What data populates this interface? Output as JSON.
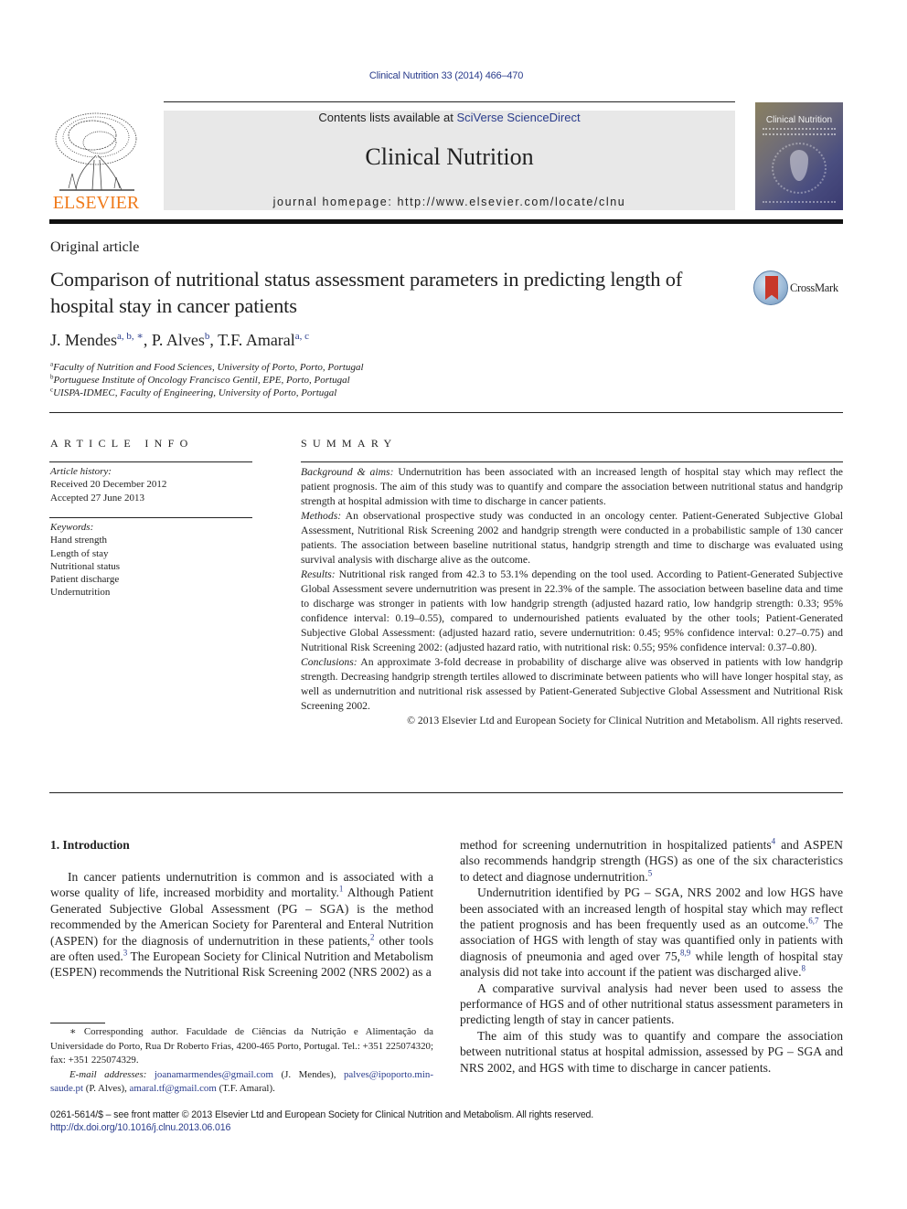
{
  "header": {
    "citation": "Clinical Nutrition 33 (2014) 466–470",
    "contents_prefix": "Contents lists available at ",
    "contents_link": "SciVerse ScienceDirect",
    "journal_title": "Clinical Nutrition",
    "homepage_label": "journal homepage: ",
    "homepage_url": "http://www.elsevier.com/locate/clnu",
    "publisher_logo_text": "ELSEVIER",
    "cover_title": "Clinical Nutrition",
    "colors": {
      "link": "#2a3c8c",
      "elsevier_orange": "#f07a1a",
      "header_box": "#e8e8e8"
    }
  },
  "article": {
    "type": "Original article",
    "title": "Comparison of nutritional status assessment parameters in predicting length of hospital stay in cancer patients",
    "crossmark_label": "CrossMark",
    "authors": [
      {
        "name": "J. Mendes",
        "marks": "a, b, ∗",
        "sep": ", "
      },
      {
        "name": "P. Alves",
        "marks": "b",
        "sep": ", "
      },
      {
        "name": "T.F. Amaral",
        "marks": "a, c",
        "sep": ""
      }
    ],
    "affiliations": [
      {
        "mark": "a",
        "text": "Faculty of Nutrition and Food Sciences, University of Porto, Porto, Portugal"
      },
      {
        "mark": "b",
        "text": "Portuguese Institute of Oncology Francisco Gentil, EPE, Porto, Portugal"
      },
      {
        "mark": "c",
        "text": "UISPA-IDMEC, Faculty of Engineering, University of Porto, Portugal"
      }
    ]
  },
  "article_info": {
    "heading": "ARTICLE INFO",
    "history_label": "Article history:",
    "received": "Received 20 December 2012",
    "accepted": "Accepted 27 June 2013",
    "keywords_label": "Keywords:",
    "keywords": [
      "Hand strength",
      "Length of stay",
      "Nutritional status",
      "Patient discharge",
      "Undernutrition"
    ]
  },
  "summary": {
    "heading": "SUMMARY",
    "sections": [
      {
        "label": "Background & aims:",
        "text": " Undernutrition has been associated with an increased length of hospital stay which may reflect the patient prognosis. The aim of this study was to quantify and compare the association between nutritional status and handgrip strength at hospital admission with time to discharge in cancer patients."
      },
      {
        "label": "Methods:",
        "text": " An observational prospective study was conducted in an oncology center. Patient-Generated Subjective Global Assessment, Nutritional Risk Screening 2002 and handgrip strength were conducted in a probabilistic sample of 130 cancer patients. The association between baseline nutritional status, handgrip strength and time to discharge was evaluated using survival analysis with discharge alive as the outcome."
      },
      {
        "label": "Results:",
        "text": " Nutritional risk ranged from 42.3 to 53.1% depending on the tool used. According to Patient-Generated Subjective Global Assessment severe undernutrition was present in 22.3% of the sample. The association between baseline data and time to discharge was stronger in patients with low handgrip strength (adjusted hazard ratio, low handgrip strength: 0.33; 95% confidence interval: 0.19–0.55), compared to undernourished patients evaluated by the other tools; Patient-Generated Subjective Global Assessment: (adjusted hazard ratio, severe undernutrition: 0.45; 95% confidence interval: 0.27–0.75) and Nutritional Risk Screening 2002: (adjusted hazard ratio, with nutritional risk: 0.55; 95% confidence interval: 0.37–0.80)."
      },
      {
        "label": "Conclusions:",
        "text": " An approximate 3-fold decrease in probability of discharge alive was observed in patients with low handgrip strength. Decreasing handgrip strength tertiles allowed to discriminate between patients who will have longer hospital stay, as well as undernutrition and nutritional risk assessed by Patient-Generated Subjective Global Assessment and Nutritional Risk Screening 2002."
      }
    ],
    "copyright": "© 2013 Elsevier Ltd and European Society for Clinical Nutrition and Metabolism. All rights reserved."
  },
  "body": {
    "intro_heading": "1.  Introduction",
    "left_paragraphs": [
      {
        "parts": [
          {
            "t": "In cancer patients undernutrition is common and is associated with a worse quality of life, increased morbidity and mortality."
          },
          {
            "ref": "1"
          },
          {
            "t": " Although Patient Generated Subjective Global Assessment (PG – SGA) is the method recommended by the American Society for Parenteral and Enteral Nutrition (ASPEN) for the diagnosis of undernutrition in these patients,"
          },
          {
            "ref": "2"
          },
          {
            "t": " other tools are often used."
          },
          {
            "ref": "3"
          },
          {
            "t": " The European Society for Clinical Nutrition and Metabolism (ESPEN) recommends the Nutritional Risk Screening 2002 (NRS 2002) as a"
          }
        ]
      }
    ],
    "right_paragraphs": [
      {
        "noindent": true,
        "parts": [
          {
            "t": "method for screening undernutrition in hospitalized patients"
          },
          {
            "ref": "4"
          },
          {
            "t": " and ASPEN also recommends handgrip strength (HGS) as one of the six characteristics to detect and diagnose undernutrition."
          },
          {
            "ref": "5"
          }
        ]
      },
      {
        "parts": [
          {
            "t": "Undernutrition identified by PG – SGA, NRS 2002 and low HGS have been associated with an increased length of hospital stay which may reflect the patient prognosis and has been frequently used as an outcome."
          },
          {
            "ref": "6,7"
          },
          {
            "t": " The association of HGS with length of stay was quantified only in patients with diagnosis of pneumonia and aged over 75,"
          },
          {
            "ref": "8,9"
          },
          {
            "t": " while length of hospital stay analysis did not take into account if the patient was discharged alive."
          },
          {
            "ref": "8"
          }
        ]
      },
      {
        "parts": [
          {
            "t": "A comparative survival analysis had never been used to assess the performance of HGS and of other nutritional status assessment parameters in predicting length of stay in cancer patients."
          }
        ]
      },
      {
        "parts": [
          {
            "t": "The aim of this study was to quantify and compare the association between nutritional status at hospital admission, assessed by PG – SGA and NRS 2002, and HGS with time to discharge in cancer patients."
          }
        ]
      }
    ]
  },
  "footnote": {
    "corresponding": "∗ Corresponding author. Faculdade de Ciências da Nutrição e Alimentação da Universidade do Porto, Rua Dr Roberto Frias, 4200-465 Porto, Portugal. Tel.: +351 225074320; fax: +351 225074329.",
    "email_label": "E-mail addresses:",
    "emails": [
      {
        "address": "joanamarmendes@gmail.com",
        "who": " (J. Mendes), "
      },
      {
        "address": "palves@ipoporto.min-saude.pt",
        "who": " (P. Alves), "
      },
      {
        "address": "amaral.tf@gmail.com",
        "who": " (T.F. Amaral)."
      }
    ]
  },
  "page_footer": {
    "front_matter": "0261-5614/$ – see front matter © 2013 Elsevier Ltd and European Society for Clinical Nutrition and Metabolism. All rights reserved.",
    "doi": "http://dx.doi.org/10.1016/j.clnu.2013.06.016"
  }
}
